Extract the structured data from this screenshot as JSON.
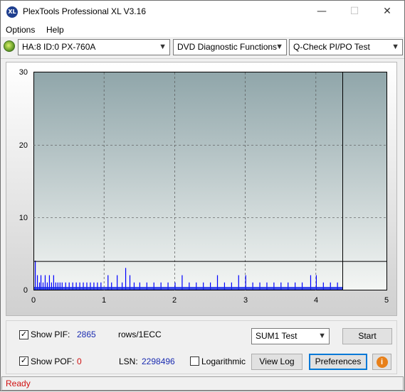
{
  "window": {
    "title": "PlexTools Professional XL V3.16",
    "app_icon_text": "XL",
    "minimize": "—",
    "maximize": "☐",
    "close": "✕"
  },
  "menu": {
    "items": [
      "Options",
      "Help"
    ]
  },
  "toolbar": {
    "drive": "HA:8 ID:0  PX-760A",
    "function": "DVD Diagnostic Functions",
    "test": "Q-Check PI/PO Test"
  },
  "chart_data": {
    "type": "bar",
    "xlim": [
      0,
      5
    ],
    "ylim": [
      0,
      30
    ],
    "xticks": [
      "0",
      "1",
      "2",
      "3",
      "4",
      "5"
    ],
    "yticks": [
      "30",
      "20",
      "10",
      "0"
    ],
    "grid": true,
    "end_marker_x": 4.38,
    "threshold_y": 4,
    "series": [
      {
        "values_note_free": true,
        "values": [
          [
            0.02,
            4
          ],
          [
            0.05,
            2
          ],
          [
            0.08,
            1
          ],
          [
            0.1,
            2
          ],
          [
            0.13,
            1
          ],
          [
            0.16,
            2
          ],
          [
            0.19,
            1
          ],
          [
            0.22,
            2
          ],
          [
            0.25,
            1
          ],
          [
            0.28,
            2
          ],
          [
            0.31,
            1
          ],
          [
            0.34,
            1
          ],
          [
            0.37,
            1
          ],
          [
            0.4,
            1
          ],
          [
            0.45,
            1
          ],
          [
            0.5,
            1
          ],
          [
            0.55,
            1
          ],
          [
            0.6,
            1
          ],
          [
            0.65,
            1
          ],
          [
            0.7,
            1
          ],
          [
            0.75,
            1
          ],
          [
            0.8,
            1
          ],
          [
            0.85,
            1
          ],
          [
            0.9,
            1
          ],
          [
            0.95,
            1
          ],
          [
            1.05,
            2
          ],
          [
            1.1,
            1
          ],
          [
            1.18,
            2
          ],
          [
            1.25,
            1
          ],
          [
            1.3,
            3
          ],
          [
            1.36,
            2
          ],
          [
            1.42,
            1
          ],
          [
            1.5,
            1
          ],
          [
            1.6,
            1
          ],
          [
            1.7,
            1
          ],
          [
            1.8,
            1
          ],
          [
            1.9,
            1
          ],
          [
            2.0,
            1
          ],
          [
            2.1,
            2
          ],
          [
            2.2,
            1
          ],
          [
            2.3,
            1
          ],
          [
            2.4,
            1
          ],
          [
            2.5,
            1
          ],
          [
            2.6,
            2
          ],
          [
            2.7,
            1
          ],
          [
            2.8,
            1
          ],
          [
            2.9,
            2
          ],
          [
            3.0,
            2
          ],
          [
            3.1,
            1
          ],
          [
            3.2,
            1
          ],
          [
            3.3,
            1
          ],
          [
            3.4,
            1
          ],
          [
            3.5,
            1
          ],
          [
            3.6,
            1
          ],
          [
            3.7,
            1
          ],
          [
            3.8,
            1
          ],
          [
            3.92,
            2
          ],
          [
            4.0,
            2
          ],
          [
            4.1,
            1
          ],
          [
            4.2,
            1
          ],
          [
            4.3,
            1
          ]
        ]
      }
    ]
  },
  "bottom": {
    "show_pif_label": "Show PIF:",
    "pif_value": "2865",
    "rows_label": "rows/1ECC",
    "show_pof_label": "Show POF:",
    "pof_value": "0",
    "lsn_label": "LSN:",
    "lsn_value": "2298496",
    "logarithmic_label": "Logarithmic",
    "sum_select": "SUM1 Test",
    "start_label": "Start",
    "viewlog_label": "View Log",
    "preferences_label": "Preferences",
    "info_icon": "i"
  },
  "status": {
    "text": "Ready"
  }
}
